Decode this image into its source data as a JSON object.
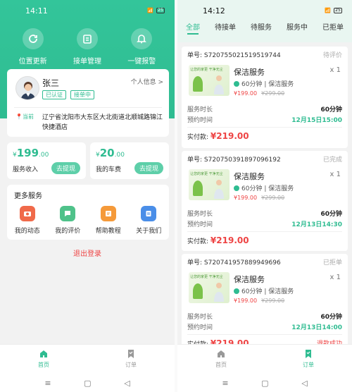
{
  "left": {
    "status_time": "14:11",
    "hero_actions": [
      {
        "label": "位置更新",
        "icon": "refresh-icon"
      },
      {
        "label": "接单管理",
        "icon": "briefcase-icon"
      },
      {
        "label": "一键报警",
        "icon": "bell-icon"
      }
    ],
    "profile": {
      "name": "张三",
      "tags": [
        "已认证",
        "接单中"
      ],
      "info_link": "个人信息 >",
      "location_badge": "当前",
      "address": "辽宁省沈阳市大东区大北街道北顺城路锦江快捷酒店"
    },
    "income": {
      "currency": "¥",
      "integer": "199",
      "decimal": ".00",
      "label": "服务收入",
      "button": "去提现"
    },
    "car_fee": {
      "currency": "¥",
      "integer": "20",
      "decimal": ".00",
      "label": "我的车费",
      "button": "去提现"
    },
    "more_services": {
      "title": "更多服务",
      "items": [
        {
          "label": "我的动态",
          "color": "#f06a4a",
          "icon": "camera-icon"
        },
        {
          "label": "我的评价",
          "color": "#4fc28a",
          "icon": "chat-icon"
        },
        {
          "label": "帮助教程",
          "color": "#f59a3a",
          "icon": "book-icon"
        },
        {
          "label": "关于我们",
          "color": "#4a8ee8",
          "icon": "info-icon"
        }
      ]
    },
    "logout": "退出登录",
    "tabs": [
      {
        "label": "首页",
        "icon": "home-icon",
        "active": true
      },
      {
        "label": "订单",
        "icon": "bookmark-icon",
        "active": false
      }
    ]
  },
  "right": {
    "status_time": "14:12",
    "tabs": [
      "全部",
      "待接单",
      "待服务",
      "服务中",
      "已拒单"
    ],
    "orders": [
      {
        "number": "单号: S720755021519519744",
        "status": "待评价",
        "thumb_text": "让您的家更\n干净无尘",
        "title": "保洁服务",
        "qty": "x 1",
        "meta": "60分钟 | 保洁服务",
        "price": "¥199.00",
        "old_price": "¥299.00",
        "duration_label": "服务时长",
        "duration": "60分钟",
        "time_label": "预约时间",
        "time": "12月15日15:00",
        "pay_label": "实付款:",
        "pay": "¥219.00"
      },
      {
        "number": "单号: S720750391897096192",
        "status": "已完成",
        "thumb_text": "让您的家更\n干净无尘",
        "title": "保洁服务",
        "qty": "x 1",
        "meta": "60分钟 | 保洁服务",
        "price": "¥199.00",
        "old_price": "¥299.00",
        "duration_label": "服务时长",
        "duration": "60分钟",
        "time_label": "预约时间",
        "time": "12月13日14:30",
        "pay_label": "实付款:",
        "pay": "¥219.00"
      },
      {
        "number": "单号: S720741957889949696",
        "status": "已拒单",
        "thumb_text": "让您的家更\n干净无尘",
        "title": "保洁服务",
        "qty": "x 1",
        "meta": "60分钟 | 保洁服务",
        "price": "¥199.00",
        "old_price": "¥299.00",
        "duration_label": "服务时长",
        "duration": "60分钟",
        "time_label": "预约时间",
        "time": "12月13日14:00",
        "pay_label": "实付款:",
        "pay": "¥219.00",
        "refund": "退款成功"
      }
    ],
    "bottom_tabs": [
      {
        "label": "首页",
        "icon": "home-icon",
        "active": false
      },
      {
        "label": "订单",
        "icon": "bookmark-icon",
        "active": true
      }
    ]
  },
  "colors": {
    "accent": "#2fbc91",
    "price": "#e44444"
  }
}
